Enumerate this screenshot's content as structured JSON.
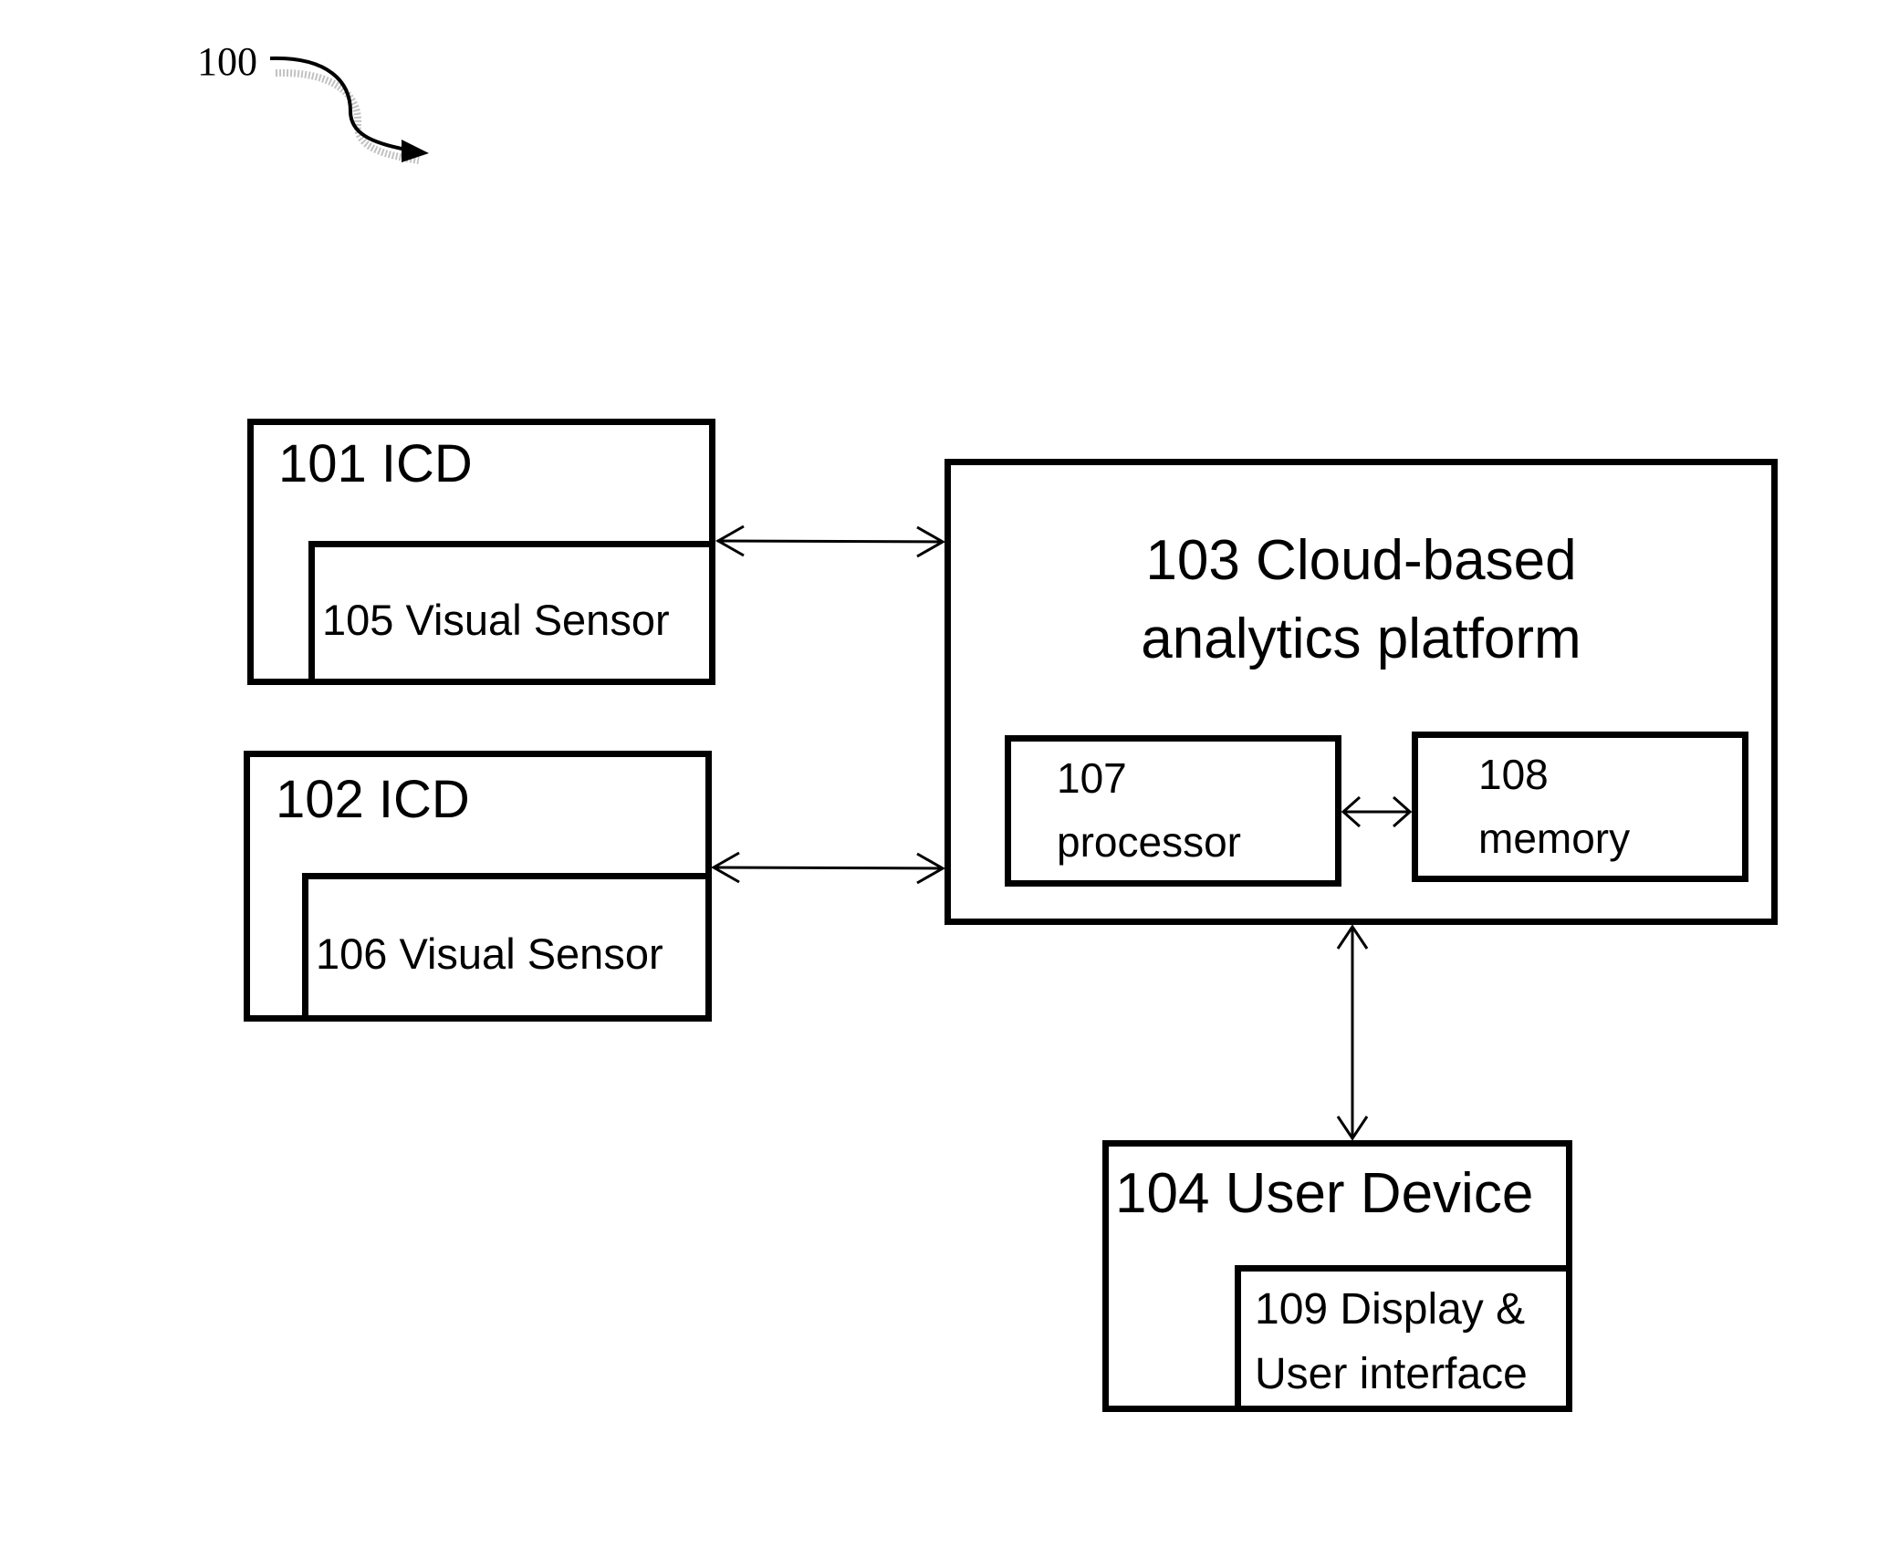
{
  "figure": {
    "ref_label": "100"
  },
  "nodes": {
    "icd_101": {
      "label": "101 ICD"
    },
    "sensor_105": {
      "label": "105 Visual Sensor"
    },
    "icd_102": {
      "label": "102 ICD"
    },
    "sensor_106": {
      "label": "106 Visual Sensor"
    },
    "cloud_103": {
      "line1": "103 Cloud-based",
      "line2": "analytics platform"
    },
    "processor_107": {
      "line1": "107",
      "line2": "processor"
    },
    "memory_108": {
      "line1": "108",
      "line2": "memory"
    },
    "user_device_104": {
      "label": "104 User Device"
    },
    "display_109": {
      "line1": "109 Display &",
      "line2": "User interface"
    }
  },
  "connections": [
    {
      "from": "101 ICD",
      "to": "103 Cloud-based analytics platform",
      "type": "bidirectional"
    },
    {
      "from": "102 ICD",
      "to": "103 Cloud-based analytics platform",
      "type": "bidirectional"
    },
    {
      "from": "107 processor",
      "to": "108 memory",
      "type": "bidirectional"
    },
    {
      "from": "103 Cloud-based analytics platform",
      "to": "104 User Device",
      "type": "bidirectional"
    }
  ]
}
